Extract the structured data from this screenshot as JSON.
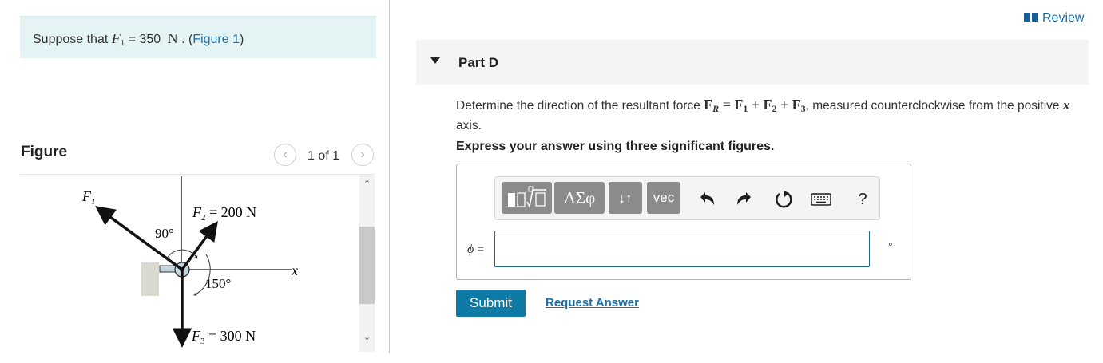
{
  "intro": {
    "prefix": "Suppose that ",
    "var": "F",
    "var_sub": "1",
    "equals": " = 350 ",
    "unit": "N",
    "dot": " . (",
    "figure_link": "Figure 1",
    "close": ")"
  },
  "figure_panel": {
    "label": "Figure",
    "page_count": "1 of 1",
    "prev_icon": "chevron-left-icon",
    "next_icon": "chevron-right-icon",
    "diagram": {
      "f1_label": "F",
      "f1_sub": "1",
      "f2_label": "F",
      "f2_sub": "2",
      "f2_value": " = 200 N",
      "f3_label": "F",
      "f3_sub": "3",
      "f3_value": " = 300 N",
      "angle_90": "90°",
      "angle_150": "150°",
      "x_axis": "x"
    }
  },
  "review": {
    "icon": "book-icon",
    "label": "Review"
  },
  "part": {
    "title": "Part D",
    "caret_icon": "caret-down-icon"
  },
  "question": {
    "text_before": "Determine the direction of the resultant force ",
    "fr": "F",
    "fr_sub": "R",
    "eq1": " = ",
    "f1": "F",
    "f1_sub": "1",
    "plus1": " + ",
    "f2": "F",
    "f2_sub": "2",
    "plus2": " + ",
    "f3": "F",
    "f3_sub": "3",
    "text_after": ", measured counterclockwise from the positive ",
    "x_var": "x",
    "axis_word": " axis.",
    "instruction": "Express your answer using three significant figures."
  },
  "toolbar": {
    "templates_icon": "templates-icon",
    "greek_label": "ΑΣφ",
    "sort_label": "↓↑",
    "vec_label": "vec",
    "undo_icon": "undo-icon",
    "redo_icon": "redo-icon",
    "reset_icon": "reset-icon",
    "keyboard_icon": "keyboard-icon",
    "help_label": "?"
  },
  "answer": {
    "var": "ϕ",
    "equals": " =",
    "value": "",
    "unit": "°"
  },
  "actions": {
    "submit_label": "Submit",
    "request_label": "Request Answer"
  },
  "colors": {
    "accent": "#0e7aa6",
    "link": "#1a6ea8",
    "intro_bg": "#e4f4f4",
    "part_bar_bg": "#f4f4f4",
    "toolbar_button": "#8b8b8b"
  }
}
